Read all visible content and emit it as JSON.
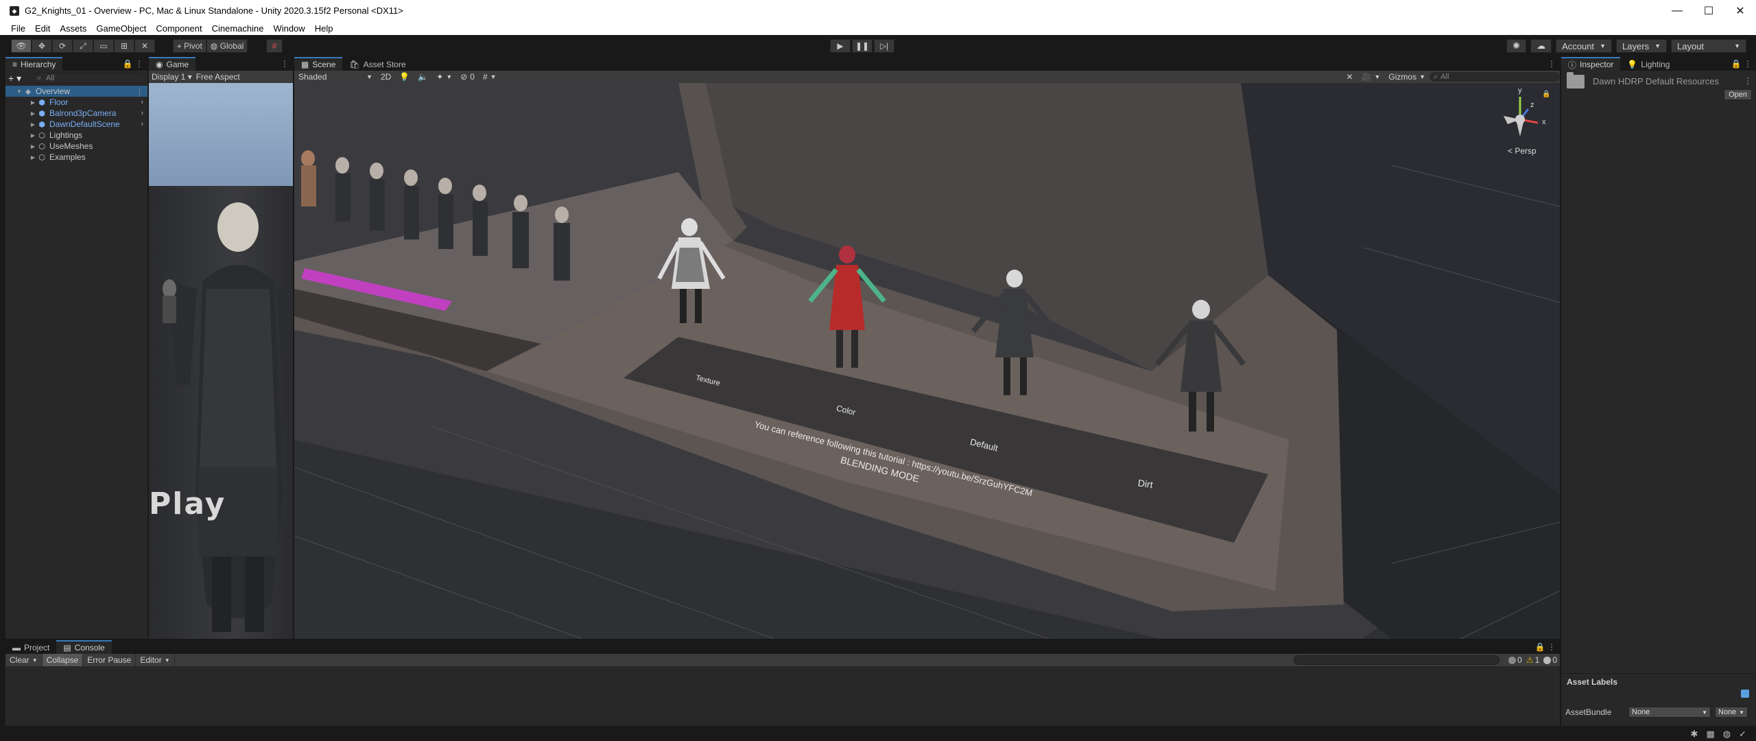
{
  "window": {
    "title": "G2_Knights_01 - Overview - PC, Mac & Linux Standalone - Unity 2020.3.15f2 Personal <DX11>",
    "controls": [
      "—",
      "☐",
      "✕"
    ]
  },
  "menu": [
    "File",
    "Edit",
    "Assets",
    "GameObject",
    "Component",
    "Cinemachine",
    "Window",
    "Help"
  ],
  "toolbar": {
    "pivot_label": "Pivot",
    "global_label": "Global",
    "account_label": "Account",
    "layers_label": "Layers",
    "layout_label": "Layout"
  },
  "hierarchy": {
    "tab": "Hierarchy",
    "search_placeholder": "All",
    "scene": "Overview",
    "items": [
      {
        "label": "Floor",
        "type": "prefab"
      },
      {
        "label": "Balrond3pCamera",
        "type": "prefab"
      },
      {
        "label": "DawnDefaultScene",
        "type": "prefab"
      },
      {
        "label": "Lightings",
        "type": "object"
      },
      {
        "label": "UseMeshes",
        "type": "object"
      },
      {
        "label": "Examples",
        "type": "object"
      }
    ]
  },
  "game": {
    "tab": "Game",
    "display": "Display 1",
    "aspect": "Free Aspect",
    "overlay_text": "Play"
  },
  "scene": {
    "tabs": [
      "Scene",
      "Asset Store"
    ],
    "shading": "Shaded",
    "mode_2d": "2D",
    "fx_count": "0",
    "gizmos_label": "Gizmos",
    "search_placeholder": "All",
    "persp_label": "Persp",
    "axes": {
      "y": "y",
      "z": "z",
      "x": "x"
    },
    "floor_labels": {
      "texture": "Texture",
      "color": "Color",
      "default": "Default",
      "dirt": "Dirt",
      "tutorial": "You can reference following this tutorial : https://youtu.be/SrzGuhYFC2M",
      "blending": "BLENDING MODE"
    }
  },
  "inspector": {
    "tabs": [
      "Inspector",
      "Lighting"
    ],
    "asset_name": "Dawn HDRP Default Resources",
    "open_label": "Open",
    "asset_labels_title": "Asset Labels",
    "asset_bundle_label": "AssetBundle",
    "bundle_value": "None",
    "variant_value": "None"
  },
  "console": {
    "tabs": [
      "Project",
      "Console"
    ],
    "clear_label": "Clear",
    "collapse_label": "Collapse",
    "error_pause_label": "Error Pause",
    "editor_label": "Editor",
    "log_count": "0",
    "warn_count": "1",
    "error_count": "0"
  },
  "colors": {
    "accent": "#3a79bb",
    "prefab_text": "#7baef5",
    "panel_bg": "#282828"
  }
}
